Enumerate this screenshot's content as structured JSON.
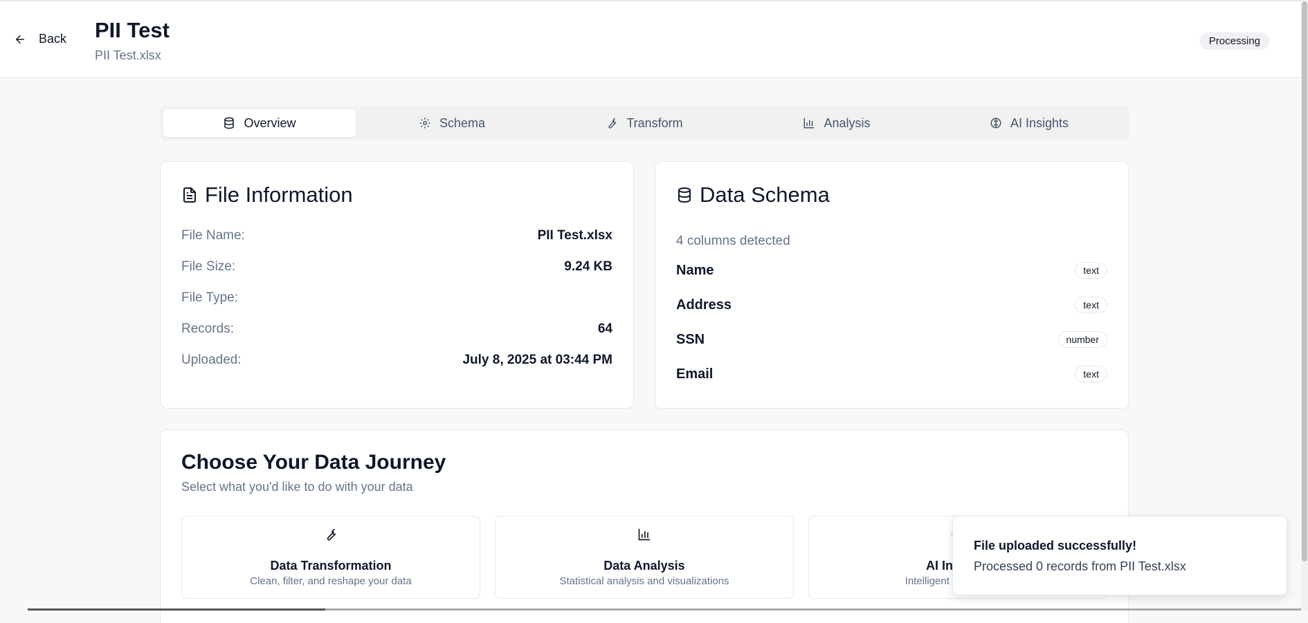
{
  "header": {
    "back_label": "Back",
    "title": "PII Test",
    "subtitle": "PII Test.xlsx",
    "status": "Processing"
  },
  "tabs": [
    {
      "label": "Overview",
      "icon": "database-icon",
      "active": true
    },
    {
      "label": "Schema",
      "icon": "gear-icon",
      "active": false
    },
    {
      "label": "Transform",
      "icon": "wrench-icon",
      "active": false
    },
    {
      "label": "Analysis",
      "icon": "bar-chart-icon",
      "active": false
    },
    {
      "label": "AI Insights",
      "icon": "brain-icon",
      "active": false
    }
  ],
  "file_info": {
    "title": "File Information",
    "icon": "file-text-icon",
    "rows": [
      {
        "label": "File Name:",
        "value": "PII Test.xlsx"
      },
      {
        "label": "File Size:",
        "value": "9.24 KB"
      },
      {
        "label": "File Type:",
        "value": ""
      },
      {
        "label": "Records:",
        "value": "64"
      },
      {
        "label": "Uploaded:",
        "value": "July 8, 2025 at 03:44 PM"
      }
    ]
  },
  "schema": {
    "title": "Data Schema",
    "icon": "database-icon",
    "summary": "4 columns detected",
    "columns": [
      {
        "name": "Name",
        "type": "text"
      },
      {
        "name": "Address",
        "type": "text"
      },
      {
        "name": "SSN",
        "type": "number"
      },
      {
        "name": "Email",
        "type": "text"
      }
    ]
  },
  "journey": {
    "title": "Choose Your Data Journey",
    "subtitle": "Select what you'd like to do with your data",
    "options": [
      {
        "title": "Data Transformation",
        "desc": "Clean, filter, and reshape your data",
        "icon": "wrench-icon"
      },
      {
        "title": "Data Analysis",
        "desc": "Statistical analysis and visualizations",
        "icon": "bar-chart-icon"
      },
      {
        "title": "AI Insights",
        "desc": "Intelligent data insights",
        "icon": "brain-icon"
      }
    ]
  },
  "toast": {
    "title": "File uploaded successfully!",
    "message": "Processed 0 records from PII Test.xlsx"
  }
}
